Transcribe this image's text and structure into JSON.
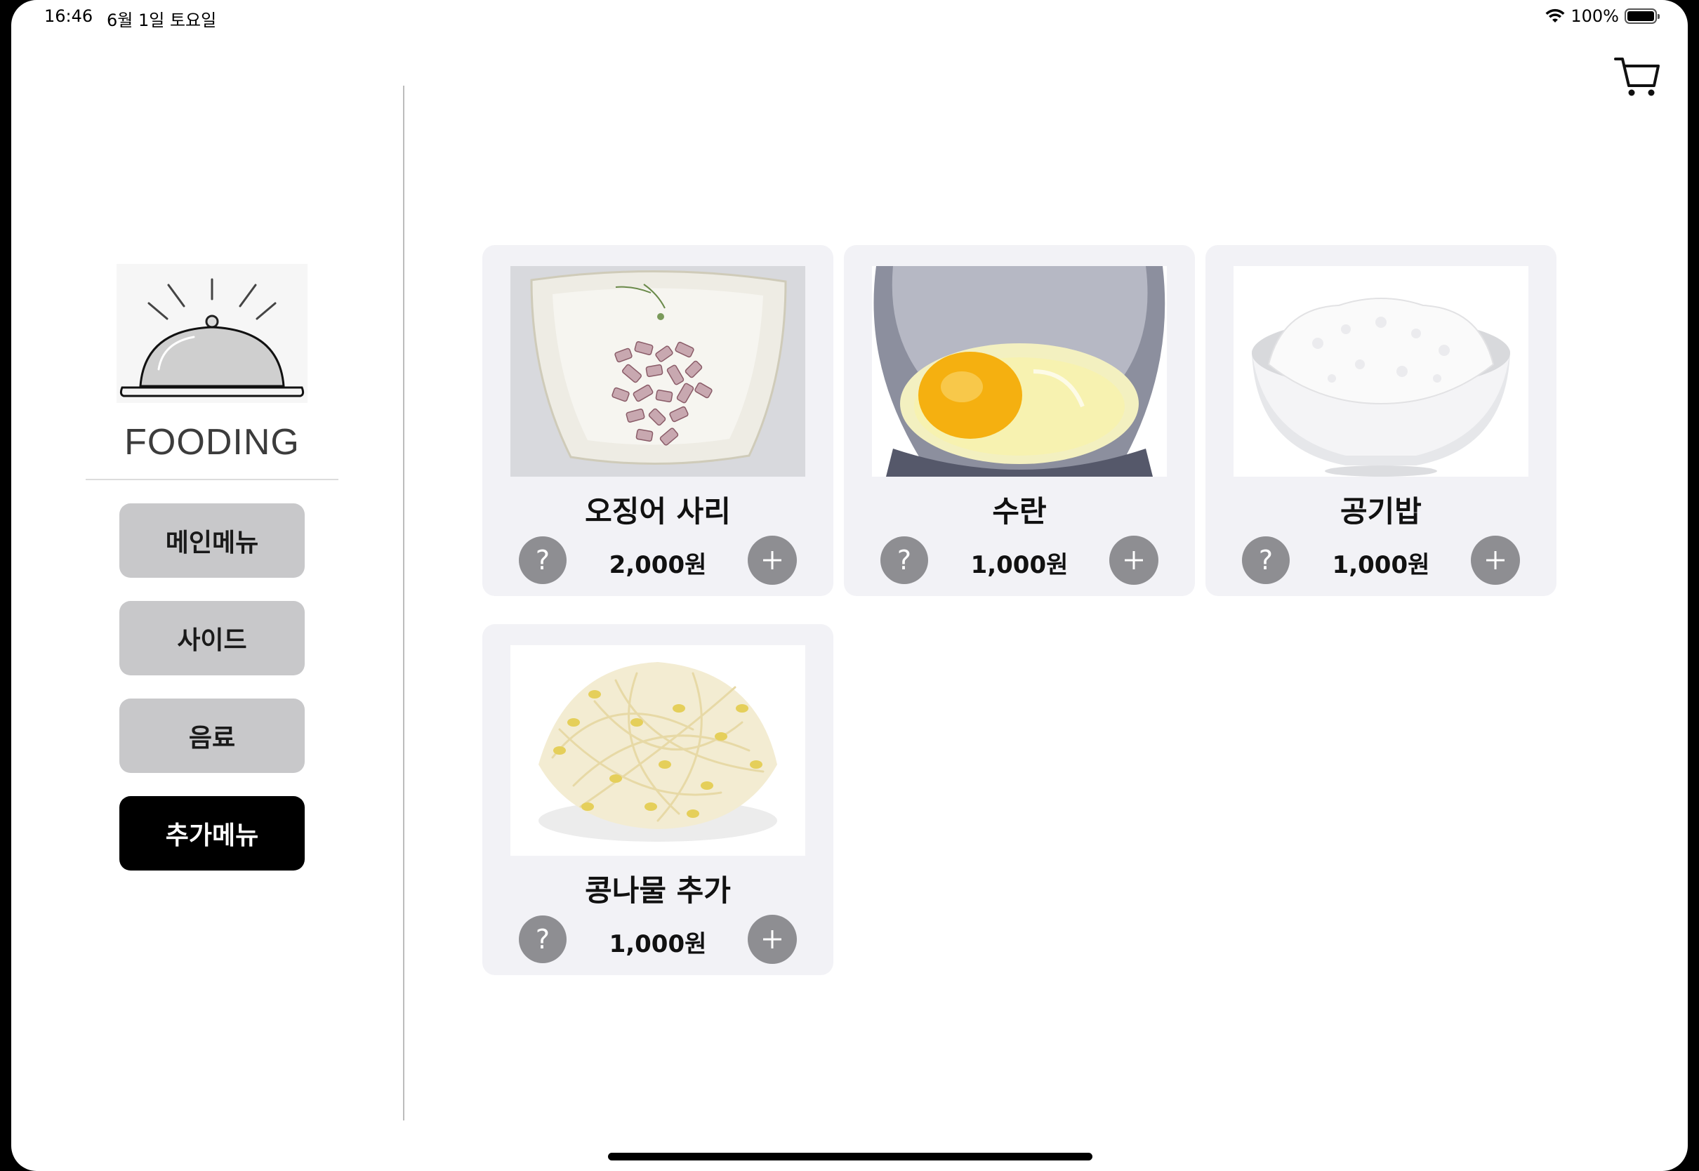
{
  "status": {
    "time": "16:46",
    "date": "6월 1일 토요일",
    "battery": "100%"
  },
  "brand": {
    "name": "FOODING"
  },
  "categories": [
    {
      "label": "메인메뉴",
      "active": false
    },
    {
      "label": "사이드",
      "active": false
    },
    {
      "label": "음료",
      "active": false
    },
    {
      "label": "추가메뉴",
      "active": true
    }
  ],
  "items": [
    {
      "name": "오징어 사리",
      "price": "2,000원",
      "icon": "squid-dish-image"
    },
    {
      "name": "수란",
      "price": "1,000원",
      "icon": "poached-egg-image"
    },
    {
      "name": "공기밥",
      "price": "1,000원",
      "icon": "rice-bowl-image"
    },
    {
      "name": "콩나물 추가",
      "price": "1,000원",
      "icon": "bean-sprouts-image"
    }
  ],
  "buttons": {
    "info_symbol": "?",
    "add_symbol": "+"
  },
  "colors": {
    "accent": "#000000",
    "category_inactive": "#c8c8ca",
    "card_bg": "#f2f2f6",
    "round_button": "#8e8e92"
  }
}
